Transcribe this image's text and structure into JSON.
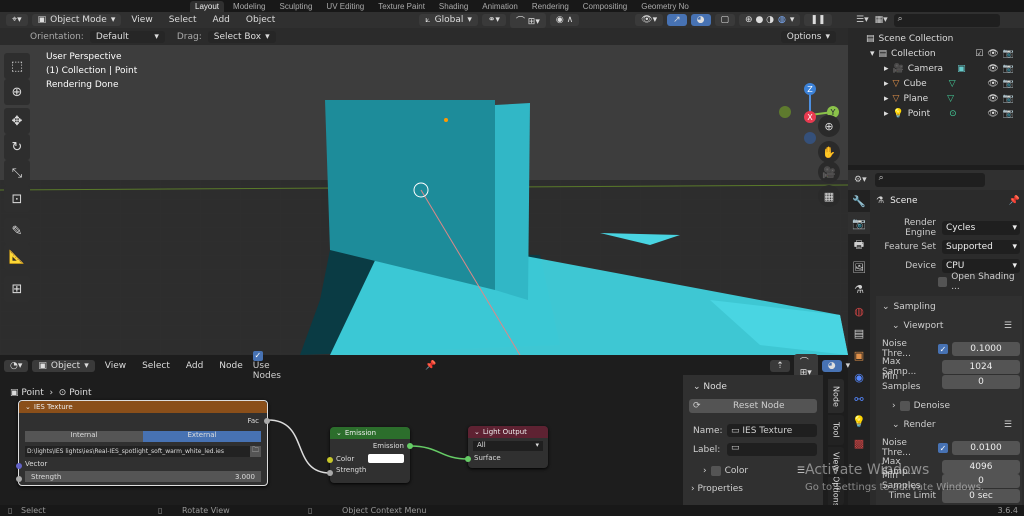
{
  "workspace_tabs": [
    "Layout",
    "Modeling",
    "Sculpting",
    "UV Editing",
    "Texture Paint",
    "Shading",
    "Animation",
    "Rendering",
    "Compositing",
    "Geometry No"
  ],
  "viewport": {
    "mode": "Object Mode",
    "menus": [
      "View",
      "Select",
      "Add",
      "Object"
    ],
    "transform": "Global",
    "orientation_label": "Orientation:",
    "orientation": "Default",
    "drag_label": "Drag:",
    "drag": "Select Box",
    "options": "Options",
    "overlay": [
      "User Perspective",
      "(1) Collection | Point",
      "Rendering Done"
    ],
    "gizmo": {
      "z": "Z",
      "y": "Y",
      "x": "X"
    }
  },
  "outliner": {
    "root": "Scene Collection",
    "collection": "Collection",
    "items": [
      "Camera",
      "Cube",
      "Plane",
      "Point"
    ]
  },
  "properties": {
    "context": "Scene",
    "render_engine_label": "Render Engine",
    "render_engine": "Cycles",
    "feature_set_label": "Feature Set",
    "feature_set": "Supported",
    "device_label": "Device",
    "device": "CPU",
    "osl": "Open Shading ...",
    "sampling": "Sampling",
    "viewport": "Viewport",
    "noise_label": "Noise Thre...",
    "vp_noise": "0.1000",
    "max_label": "Max Samp...",
    "vp_max": "1024",
    "min_label": "Min Samples",
    "vp_min": "0",
    "denoise": "Denoise",
    "render": "Render",
    "r_noise": "0.0100",
    "r_max": "4096",
    "r_min": "0",
    "time_label": "Time Limit",
    "time": "0 sec"
  },
  "node_editor": {
    "type": "Object",
    "menus": [
      "View",
      "Select",
      "Add",
      "Node"
    ],
    "use_nodes": "Use Nodes",
    "breadcrumb": [
      "Point",
      "Point"
    ],
    "ies": {
      "title": "IES Texture",
      "fac": "Fac",
      "internal": "Internal",
      "external": "External",
      "path": "D:\\lights\\IES lights\\ies\\Real-IES_spotlight_soft_warm_white_led.ies",
      "vector": "Vector",
      "strength_label": "Strength",
      "strength": "3.000"
    },
    "emission": {
      "title": "Emission",
      "out": "Emission",
      "color": "Color",
      "strength": "Strength"
    },
    "light_output": {
      "title": "Light Output",
      "target": "All",
      "surface": "Surface"
    },
    "panel": {
      "node": "Node",
      "reset": "Reset Node",
      "name_label": "Name:",
      "name": "IES Texture",
      "label_label": "Label:",
      "color": "Color",
      "properties": "Properties"
    },
    "side_tabs": [
      "Node",
      "Tool",
      "View",
      "Options"
    ]
  },
  "status": {
    "select": "Select",
    "rotate": "Rotate View",
    "context": "Object Context Menu",
    "version": "3.6.4"
  },
  "watermark": {
    "title": "Activate Windows",
    "sub": "Go to Settings to activate Windows."
  }
}
